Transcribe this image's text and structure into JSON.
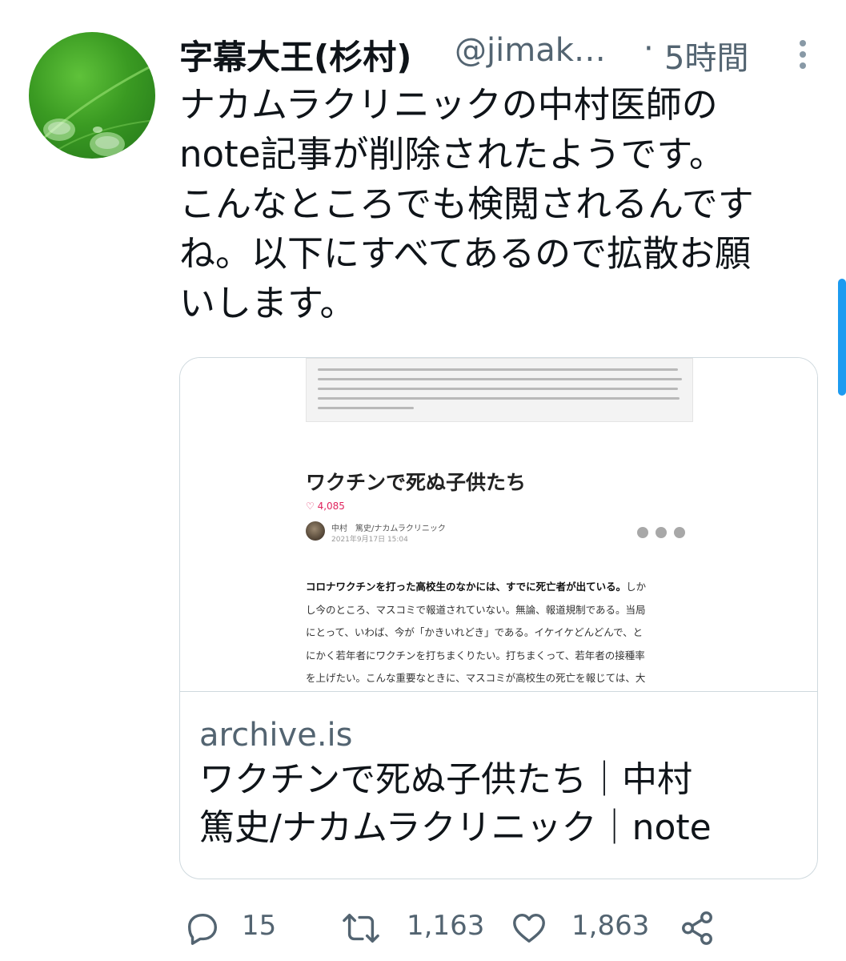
{
  "tweet": {
    "display_name": "字幕大王(杉村)",
    "handle": "@jimak…",
    "separator": "·",
    "time": "5時間",
    "text_lines": [
      "ナカムラクリニックの中村医師の",
      "note記事が削除されたようです。",
      "こんなところでも検閲されるんです",
      "ね。以下にすべてあるので拡散お願",
      "いします。"
    ],
    "avatar_icon": "leaf-water-drops-avatar"
  },
  "card": {
    "preview": {
      "article_title": "ワクチンで死ぬ子供たち",
      "likes": "♡ 4,085",
      "author": "中村　篤史/ナカムラクリニック",
      "date": "2021年9月17日 15:04",
      "body": [
        {
          "bold": "コロナワクチンを打った高校生のなかには、すでに死亡者が出ている。",
          "rest": "しか"
        },
        {
          "bold": "",
          "rest": "し今のところ、マスコミで報道されていない。無論、報道規制である。当局"
        },
        {
          "bold": "",
          "rest": "にとって、いわば、今が「かきいれどき」である。イケイケどんどんで、と"
        },
        {
          "bold": "",
          "rest": "にかく若年者にワクチンを打ちまくりたい。打ちまくって、若年者の接種率"
        },
        {
          "bold": "",
          "rest": "を上げたい。こんな重要なときに、マスコミが高校生の死亡を報じては、大"
        }
      ]
    },
    "domain": "archive.is",
    "title_lines": [
      "ワクチンで死ぬ子供たち｜中村",
      "篤史/ナカムラクリニック｜note"
    ]
  },
  "actions": {
    "reply": {
      "icon": "reply-icon",
      "count": "15"
    },
    "retweet": {
      "icon": "retweet-icon",
      "count": "1,163"
    },
    "like": {
      "icon": "like-icon",
      "count": "1,863"
    },
    "share": {
      "icon": "share-icon"
    }
  },
  "colors": {
    "text": "#0f1419",
    "secondary": "#536471",
    "border": "#cfd9de",
    "accent": "#1d9bf0",
    "like_red": "#e0245e"
  }
}
